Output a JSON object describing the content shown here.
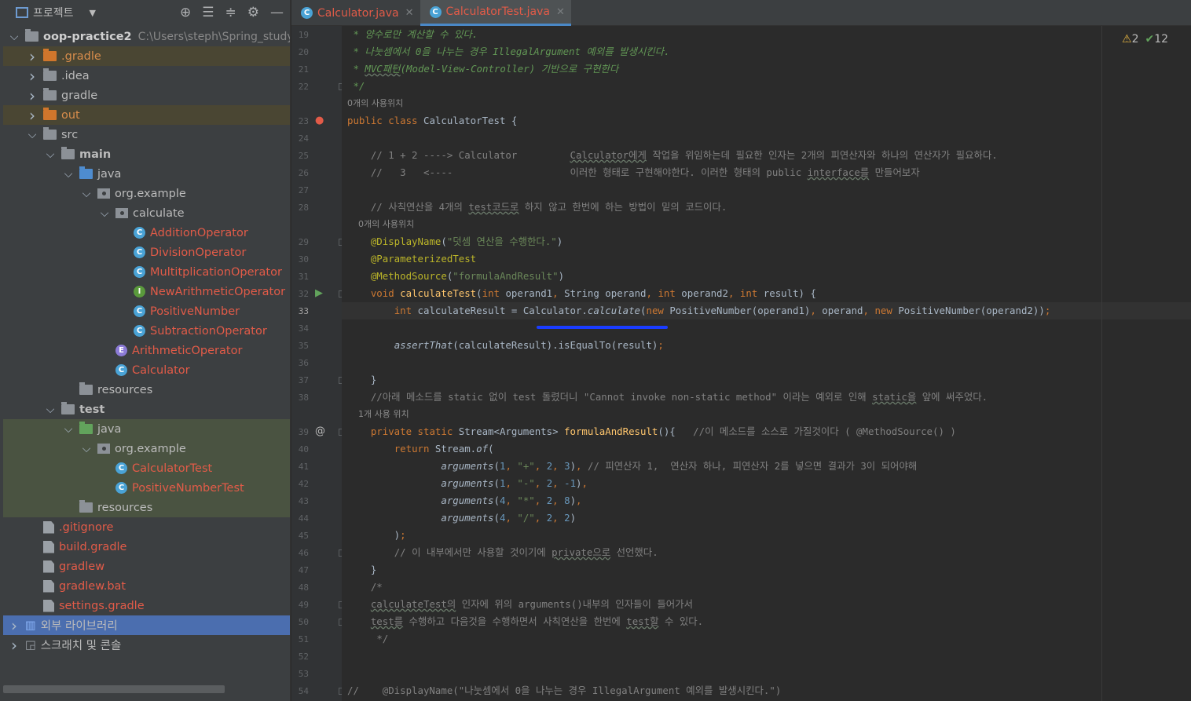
{
  "project_panel": {
    "title": "프로젝트",
    "tree": [
      {
        "label": "oop-practice2",
        "path": "C:\\Users\\steph\\Spring_study\\",
        "depth": 0,
        "arrow": "v",
        "icon": "module-folder",
        "bg": ""
      },
      {
        "label": ".gradle",
        "depth": 1,
        "arrow": ">",
        "icon": "folder-orange",
        "bg": "brown",
        "color": "orange"
      },
      {
        "label": ".idea",
        "depth": 1,
        "arrow": ">",
        "icon": "folder",
        "bg": ""
      },
      {
        "label": "gradle",
        "depth": 1,
        "arrow": ">",
        "icon": "folder",
        "bg": ""
      },
      {
        "label": "out",
        "depth": 1,
        "arrow": ">",
        "icon": "folder-orange",
        "bg": "brown",
        "color": "orange"
      },
      {
        "label": "src",
        "depth": 1,
        "arrow": "v",
        "icon": "folder",
        "bg": ""
      },
      {
        "label": "main",
        "depth": 2,
        "arrow": "v",
        "icon": "folder",
        "bg": ""
      },
      {
        "label": "java",
        "depth": 3,
        "arrow": "v",
        "icon": "folder-blue",
        "bg": ""
      },
      {
        "label": "org.example",
        "depth": 4,
        "arrow": "v",
        "icon": "package",
        "bg": ""
      },
      {
        "label": "calculate",
        "depth": 5,
        "arrow": "v",
        "icon": "package",
        "bg": ""
      },
      {
        "label": "AdditionOperator",
        "depth": 6,
        "arrow": "",
        "icon": "class",
        "bg": "",
        "color": "red"
      },
      {
        "label": "DivisionOperator",
        "depth": 6,
        "arrow": "",
        "icon": "class",
        "bg": "",
        "color": "red"
      },
      {
        "label": "MultitplicationOperator",
        "depth": 6,
        "arrow": "",
        "icon": "class",
        "bg": "",
        "color": "red"
      },
      {
        "label": "NewArithmeticOperator",
        "depth": 6,
        "arrow": "",
        "icon": "interface",
        "bg": "",
        "color": "red"
      },
      {
        "label": "PositiveNumber",
        "depth": 6,
        "arrow": "",
        "icon": "class",
        "bg": "",
        "color": "red"
      },
      {
        "label": "SubtractionOperator",
        "depth": 6,
        "arrow": "",
        "icon": "class",
        "bg": "",
        "color": "red"
      },
      {
        "label": "ArithmeticOperator",
        "depth": 5,
        "arrow": "",
        "icon": "enum",
        "bg": "",
        "color": "red"
      },
      {
        "label": "Calculator",
        "depth": 5,
        "arrow": "",
        "icon": "class",
        "bg": "",
        "color": "red"
      },
      {
        "label": "resources",
        "depth": 3,
        "arrow": "",
        "icon": "folder",
        "bg": ""
      },
      {
        "label": "test",
        "depth": 2,
        "arrow": "v",
        "icon": "folder",
        "bg": ""
      },
      {
        "label": "java",
        "depth": 3,
        "arrow": "v",
        "icon": "folder-green",
        "bg": "green"
      },
      {
        "label": "org.example",
        "depth": 4,
        "arrow": "v",
        "icon": "package",
        "bg": "green"
      },
      {
        "label": "CalculatorTest",
        "depth": 5,
        "arrow": "",
        "icon": "class",
        "bg": "green",
        "color": "red"
      },
      {
        "label": "PositiveNumberTest",
        "depth": 5,
        "arrow": "",
        "icon": "class",
        "bg": "green",
        "color": "red"
      },
      {
        "label": "resources",
        "depth": 3,
        "arrow": "",
        "icon": "folder",
        "bg": "green"
      },
      {
        "label": ".gitignore",
        "depth": 1,
        "arrow": "",
        "icon": "file",
        "bg": "",
        "color": "red"
      },
      {
        "label": "build.gradle",
        "depth": 1,
        "arrow": "",
        "icon": "file",
        "bg": "",
        "color": "red"
      },
      {
        "label": "gradlew",
        "depth": 1,
        "arrow": "",
        "icon": "file",
        "bg": "",
        "color": "red"
      },
      {
        "label": "gradlew.bat",
        "depth": 1,
        "arrow": "",
        "icon": "file",
        "bg": "",
        "color": "red"
      },
      {
        "label": "settings.gradle",
        "depth": 1,
        "arrow": "",
        "icon": "file",
        "bg": "",
        "color": "red"
      },
      {
        "label": "외부 라이브러리",
        "depth": 0,
        "arrow": ">",
        "icon": "library",
        "bg": "sel"
      },
      {
        "label": "스크래치 및 콘솔",
        "depth": 0,
        "arrow": ">",
        "icon": "scratch",
        "bg": ""
      }
    ]
  },
  "tabs": [
    {
      "label": "Calculator.java",
      "active": false
    },
    {
      "label": "CalculatorTest.java",
      "active": true
    }
  ],
  "indicators": {
    "warnings": "2",
    "checks": "12"
  },
  "code_lines": [
    {
      "n": "19",
      "html": "<span class='doc'> * 양수로만 계산할 수 있다.</span>"
    },
    {
      "n": "20",
      "html": "<span class='doc'> * 나눗셈에서 0을 나누는 경우 IllegalArgument 예외를 발생시킨다.</span>"
    },
    {
      "n": "21",
      "html": "<span class='doc'> * <span class='ul'>MVC패턴</span>(Model-View-Controller) 기반으로 구현한다</span>"
    },
    {
      "n": "22",
      "html": "<span class='doc'> */</span>"
    },
    {
      "n": "",
      "hint": "0개의 사용위치"
    },
    {
      "n": "23",
      "html": "<span class='kw'>public class</span> CalculatorTest {"
    },
    {
      "n": "24",
      "html": ""
    },
    {
      "n": "25",
      "html": "    <span class='cm'>// 1 + 2 ----> Calculator         <span class='ul'>Calculator에게</span> 작업을 위임하는데 필요한 인자는 2개의 피연산자와 하나의 연산자가 필요하다.</span>"
    },
    {
      "n": "26",
      "html": "    <span class='cm'>//   3   <----                    이러한 형태로 구현해야한다. 이러한 형태의 public <span class='ul'>interface를</span> 만들어보자</span>"
    },
    {
      "n": "27",
      "html": ""
    },
    {
      "n": "28",
      "html": "    <span class='cm'>// 사칙연산을 4개의 <span class='ul'>test코드로</span> 하지 않고 한번에 하는 방법이 밑의 코드이다.</span>"
    },
    {
      "n": "",
      "hint": "    0개의 사용위치"
    },
    {
      "n": "29",
      "html": "    <span class='an'>@DisplayName</span>(<span class='st'>\"덧셈 연산을 수행한다.\"</span>)"
    },
    {
      "n": "30",
      "html": "    <span class='an'>@ParameterizedTest</span>"
    },
    {
      "n": "31",
      "html": "    <span class='an'>@MethodSource</span>(<span class='st'>\"formulaAndResult\"</span>)"
    },
    {
      "n": "32",
      "html": "    <span class='kw'>void</span> <span class='fn'>calculateTest</span>(<span class='kw'>int</span> operand1<span class='kw'>,</span> String operand<span class='kw'>,</span> <span class='kw'>int</span> operand2<span class='kw'>,</span> <span class='kw'>int</span> result) {"
    },
    {
      "n": "33",
      "cur": true,
      "html": "        <span class='kw'>int</span> calculateResult = Calculator.<span class='it'>calculate</span>(<span class='kw'>new</span> PositiveNumber(operand1)<span class='kw'>,</span> operand<span class='kw'>,</span> <span class='kw'>new</span> PositiveNumber(operand2))<span class='kw'>;</span>"
    },
    {
      "n": "34",
      "html": ""
    },
    {
      "n": "35",
      "html": "        <span class='it'>assertThat</span>(calculateResult).isEqualTo(result)<span class='kw'>;</span>"
    },
    {
      "n": "36",
      "html": ""
    },
    {
      "n": "37",
      "html": "    }"
    },
    {
      "n": "38",
      "html": "    <span class='cm'>//아래 메소드를 static 없이 test 돌렸더니 \"Cannot invoke non-static method\" 이라는 예외로 인해 <span class='ul'>static을</span> 앞에 써주었다.</span>"
    },
    {
      "n": "",
      "hint": "    1개 사용 위치"
    },
    {
      "n": "39",
      "html": "    <span class='kw'>private static</span> Stream&lt;Arguments&gt; <span class='fn'>formulaAndResult</span>(){   <span class='cm'>//이 메소드를 소스로 가질것이다 ( @MethodSource() )</span>"
    },
    {
      "n": "40",
      "html": "        <span class='kw'>return</span> Stream.<span class='it'>of</span>("
    },
    {
      "n": "41",
      "html": "                <span class='it'>arguments</span>(<span class='nm'>1</span><span class='kw'>,</span> <span class='st'>\"+\"</span><span class='kw'>,</span> <span class='nm'>2</span><span class='kw'>,</span> <span class='nm'>3</span>)<span class='kw'>,</span> <span class='cm'>// 피연산자 1,  연산자 하나, 피연산자 2를 넣으면 결과가 3이 되어야해</span>"
    },
    {
      "n": "42",
      "html": "                <span class='it'>arguments</span>(<span class='nm'>1</span><span class='kw'>,</span> <span class='st'>\"-\"</span><span class='kw'>,</span> <span class='nm'>2</span><span class='kw'>,</span> <span class='nm'>-1</span>)<span class='kw'>,</span>"
    },
    {
      "n": "43",
      "html": "                <span class='it'>arguments</span>(<span class='nm'>4</span><span class='kw'>,</span> <span class='st'>\"*\"</span><span class='kw'>,</span> <span class='nm'>2</span><span class='kw'>,</span> <span class='nm'>8</span>)<span class='kw'>,</span>"
    },
    {
      "n": "44",
      "html": "                <span class='it'>arguments</span>(<span class='nm'>4</span><span class='kw'>,</span> <span class='st'>\"/\"</span><span class='kw'>,</span> <span class='nm'>2</span><span class='kw'>,</span> <span class='nm'>2</span>)"
    },
    {
      "n": "45",
      "html": "        )<span class='kw'>;</span>"
    },
    {
      "n": "46",
      "html": "        <span class='cm'>// 이 내부에서만 사용할 것이기에 <span class='ul'>private으로</span> 선언했다.</span>"
    },
    {
      "n": "47",
      "html": "    }"
    },
    {
      "n": "48",
      "html": "    <span class='cm'>/*</span>"
    },
    {
      "n": "49",
      "html": "    <span class='cm'><span class='ul'>calculateTest의</span> 인자에 위의 arguments()내부의 인자들이 들어가서</span>"
    },
    {
      "n": "50",
      "html": "    <span class='cm'><span class='ul'>test를</span> 수행하고 다음것을 수행하면서 사칙연산을 한번에 <span class='ul'>test할</span> 수 있다.</span>"
    },
    {
      "n": "51",
      "html": "     <span class='cm'>*/</span>"
    },
    {
      "n": "52",
      "html": ""
    },
    {
      "n": "53",
      "html": ""
    },
    {
      "n": "54",
      "html": "<span class='cm'>//    @DisplayName(\"나눗셈에서 0을 나누는 경우 IllegalArgument 예외를 발생시킨다.\")</span>"
    }
  ]
}
